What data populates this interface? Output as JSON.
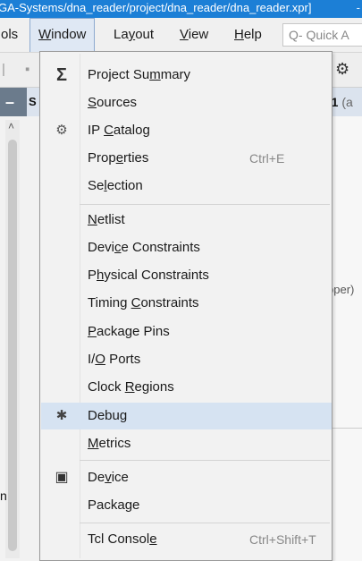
{
  "title_bar": {
    "path_text": "GA-Systems/dna_reader/project/dna_reader/dna_reader.xpr]",
    "trailing": "-"
  },
  "menubar": {
    "items": [
      {
        "label": "ols"
      },
      {
        "label": "Window",
        "underline_char": "W",
        "active": true
      },
      {
        "label": "Layout",
        "underline_char": "y"
      },
      {
        "label": "View",
        "underline_char": "V"
      },
      {
        "label": "Help",
        "underline_char": "H"
      }
    ],
    "quick_access_placeholder": "Q- Quick A"
  },
  "left_panel": {
    "header_symbol": "–",
    "header_tab": "S",
    "clipped_text": "n"
  },
  "right_strip": {
    "header_text": "-1",
    "header_suffix": "(a",
    "clipped_text": "pper)"
  },
  "window_menu": {
    "items": [
      {
        "pre": "Project Su",
        "u": "m",
        "post": "mary",
        "icon": "sigma-icon",
        "icon_glyph": "Σ",
        "shortcut": ""
      },
      {
        "pre": "",
        "u": "S",
        "post": "ources",
        "icon": "",
        "icon_glyph": "",
        "shortcut": ""
      },
      {
        "pre": "IP ",
        "u": "C",
        "post": "atalog",
        "icon": "ip-catalog-icon",
        "icon_glyph": "⚙",
        "shortcut": ""
      },
      {
        "pre": "Prop",
        "u": "e",
        "post": "rties",
        "icon": "",
        "icon_glyph": "",
        "shortcut": "Ctrl+E"
      },
      {
        "pre": "Se",
        "u": "l",
        "post": "ection",
        "icon": "",
        "icon_glyph": "",
        "shortcut": ""
      },
      {
        "pre": "",
        "u": "N",
        "post": "etlist",
        "icon": "",
        "icon_glyph": "",
        "shortcut": ""
      },
      {
        "pre": "Devi",
        "u": "c",
        "post": "e Constraints",
        "icon": "",
        "icon_glyph": "",
        "shortcut": ""
      },
      {
        "pre": "P",
        "u": "h",
        "post": "ysical Constraints",
        "icon": "",
        "icon_glyph": "",
        "shortcut": ""
      },
      {
        "pre": "Timing ",
        "u": "C",
        "post": "onstraints",
        "icon": "",
        "icon_glyph": "",
        "shortcut": ""
      },
      {
        "pre": "",
        "u": "P",
        "post": "ackage Pins",
        "icon": "",
        "icon_glyph": "",
        "shortcut": ""
      },
      {
        "pre": "I/",
        "u": "O",
        "post": " Ports",
        "icon": "",
        "icon_glyph": "",
        "shortcut": ""
      },
      {
        "pre": "Clock ",
        "u": "R",
        "post": "egions",
        "icon": "",
        "icon_glyph": "",
        "shortcut": ""
      },
      {
        "pre": "Debug",
        "u": "",
        "post": "",
        "icon": "bug-icon",
        "icon_glyph": "✱",
        "shortcut": "",
        "highlight": true
      },
      {
        "pre": "",
        "u": "M",
        "post": "etrics",
        "icon": "",
        "icon_glyph": "",
        "shortcut": ""
      },
      {
        "pre": "De",
        "u": "v",
        "post": "ice",
        "icon": "chip-icon",
        "icon_glyph": "▣",
        "shortcut": ""
      },
      {
        "pre": "Packa",
        "u": "g",
        "post": "e",
        "icon": "",
        "icon_glyph": "",
        "shortcut": ""
      },
      {
        "pre": "Tcl Consol",
        "u": "e",
        "post": "",
        "icon": "",
        "icon_glyph": "",
        "shortcut": "Ctrl+Shift+T"
      }
    ]
  },
  "colors": {
    "title_bar": "#1c7fd6",
    "menu_highlight": "#d6e3f2",
    "active_menu": "#dfe8f4"
  }
}
